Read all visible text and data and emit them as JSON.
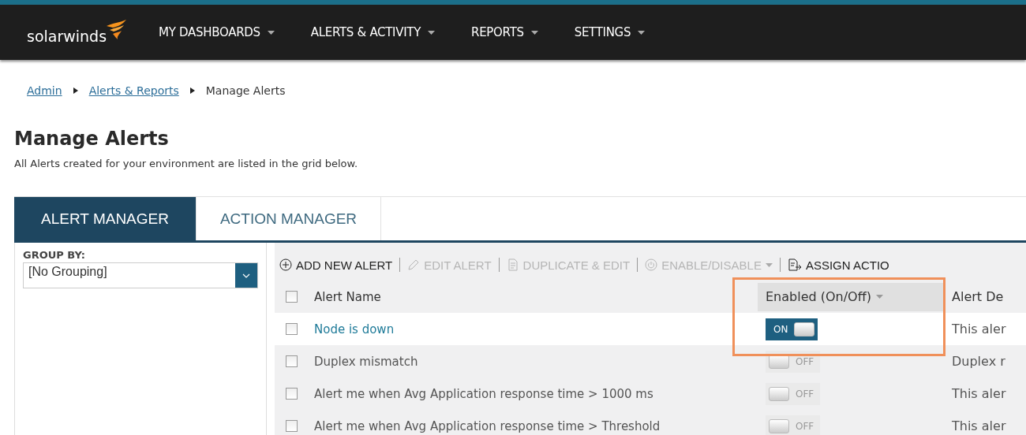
{
  "brand": "solarwinds",
  "nav": [
    {
      "label": "MY DASHBOARDS"
    },
    {
      "label": "ALERTS & ACTIVITY"
    },
    {
      "label": "REPORTS"
    },
    {
      "label": "SETTINGS"
    }
  ],
  "breadcrumb": [
    {
      "label": "Admin",
      "link": true
    },
    {
      "label": "Alerts & Reports",
      "link": true
    },
    {
      "label": "Manage Alerts",
      "link": false
    }
  ],
  "title": "Manage Alerts",
  "subtitle": "All Alerts created for your environment are listed in the grid below.",
  "tabs": [
    {
      "label": "ALERT MANAGER",
      "selected": true
    },
    {
      "label": "ACTION MANAGER",
      "selected": false
    }
  ],
  "group_by": {
    "label": "GROUP BY:",
    "value": "[No Grouping]"
  },
  "toolbar": [
    {
      "kind": "add",
      "label": "ADD NEW ALERT",
      "disabled": false
    },
    {
      "kind": "edit",
      "label": "EDIT ALERT",
      "disabled": true
    },
    {
      "kind": "duplicate",
      "label": "DUPLICATE & EDIT",
      "disabled": true
    },
    {
      "kind": "power",
      "label": "ENABLE/DISABLE",
      "disabled": true,
      "dropdown": true
    },
    {
      "kind": "assign",
      "label": "ASSIGN ACTIO",
      "disabled": false
    }
  ],
  "table": {
    "header_checked": false,
    "columns": [
      {
        "label": "Alert Name",
        "sortable": false,
        "highlighted": false
      },
      {
        "label": "Enabled (On/Off)",
        "sortable": true,
        "highlighted": true
      },
      {
        "label": "Alert De",
        "sortable": false,
        "highlighted": false
      }
    ],
    "rows": [
      {
        "checked": false,
        "name": "Node is down",
        "enabled": true,
        "on_label": "ON",
        "description": "This aler"
      },
      {
        "checked": false,
        "name": "Duplex mismatch",
        "enabled": false,
        "on_label": "OFF",
        "description": "Duplex r"
      },
      {
        "checked": false,
        "name": "Alert me when Avg Application response time > 1000 ms",
        "enabled": false,
        "on_label": "OFF",
        "description": "This aler"
      },
      {
        "checked": false,
        "name": "Alert me when Avg Application response time > Threshold",
        "enabled": false,
        "on_label": "OFF",
        "description": "This aler"
      }
    ]
  }
}
